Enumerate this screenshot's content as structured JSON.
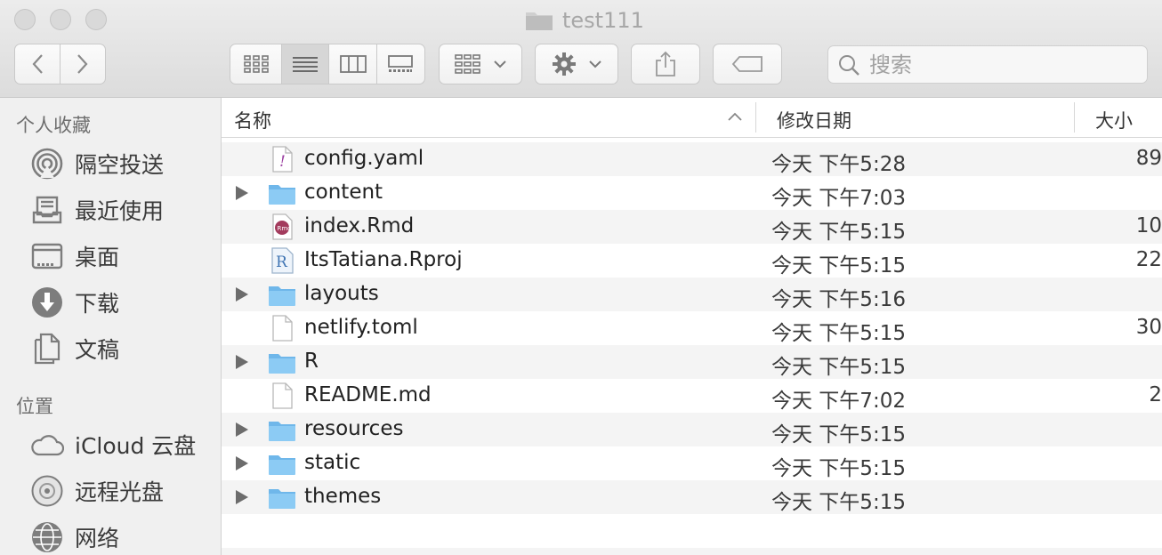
{
  "window": {
    "title": "test111"
  },
  "toolbar": {
    "search_placeholder": "搜索"
  },
  "sidebar": {
    "favorites_header": "个人收藏",
    "favorites": [
      {
        "label": "隔空投送",
        "icon": "airdrop-icon"
      },
      {
        "label": "最近使用",
        "icon": "recents-icon"
      },
      {
        "label": "桌面",
        "icon": "desktop-icon"
      },
      {
        "label": "下载",
        "icon": "downloads-icon"
      },
      {
        "label": "文稿",
        "icon": "documents-icon"
      }
    ],
    "locations_header": "位置",
    "locations": [
      {
        "label": "iCloud 云盘",
        "icon": "icloud-icon"
      },
      {
        "label": "远程光盘",
        "icon": "remote-disc-icon"
      },
      {
        "label": "网络",
        "icon": "network-icon"
      }
    ]
  },
  "columns": {
    "name": "名称",
    "date": "修改日期",
    "size": "大小"
  },
  "files": [
    {
      "name": "config.yaml",
      "date": "今天 下午5:28",
      "size": "89",
      "kind": "yaml"
    },
    {
      "name": "content",
      "date": "今天 下午7:03",
      "size": "",
      "kind": "folder"
    },
    {
      "name": "index.Rmd",
      "date": "今天 下午5:15",
      "size": "10",
      "kind": "rmd"
    },
    {
      "name": "ItsTatiana.Rproj",
      "date": "今天 下午5:15",
      "size": "22",
      "kind": "rproj"
    },
    {
      "name": "layouts",
      "date": "今天 下午5:16",
      "size": "",
      "kind": "folder"
    },
    {
      "name": "netlify.toml",
      "date": "今天 下午5:15",
      "size": "30",
      "kind": "doc"
    },
    {
      "name": "R",
      "date": "今天 下午5:15",
      "size": "",
      "kind": "folder"
    },
    {
      "name": "README.md",
      "date": "今天 下午7:02",
      "size": "2",
      "kind": "doc"
    },
    {
      "name": "resources",
      "date": "今天 下午5:15",
      "size": "",
      "kind": "folder"
    },
    {
      "name": "static",
      "date": "今天 下午5:15",
      "size": "",
      "kind": "folder"
    },
    {
      "name": "themes",
      "date": "今天 下午5:15",
      "size": "",
      "kind": "folder"
    }
  ]
}
